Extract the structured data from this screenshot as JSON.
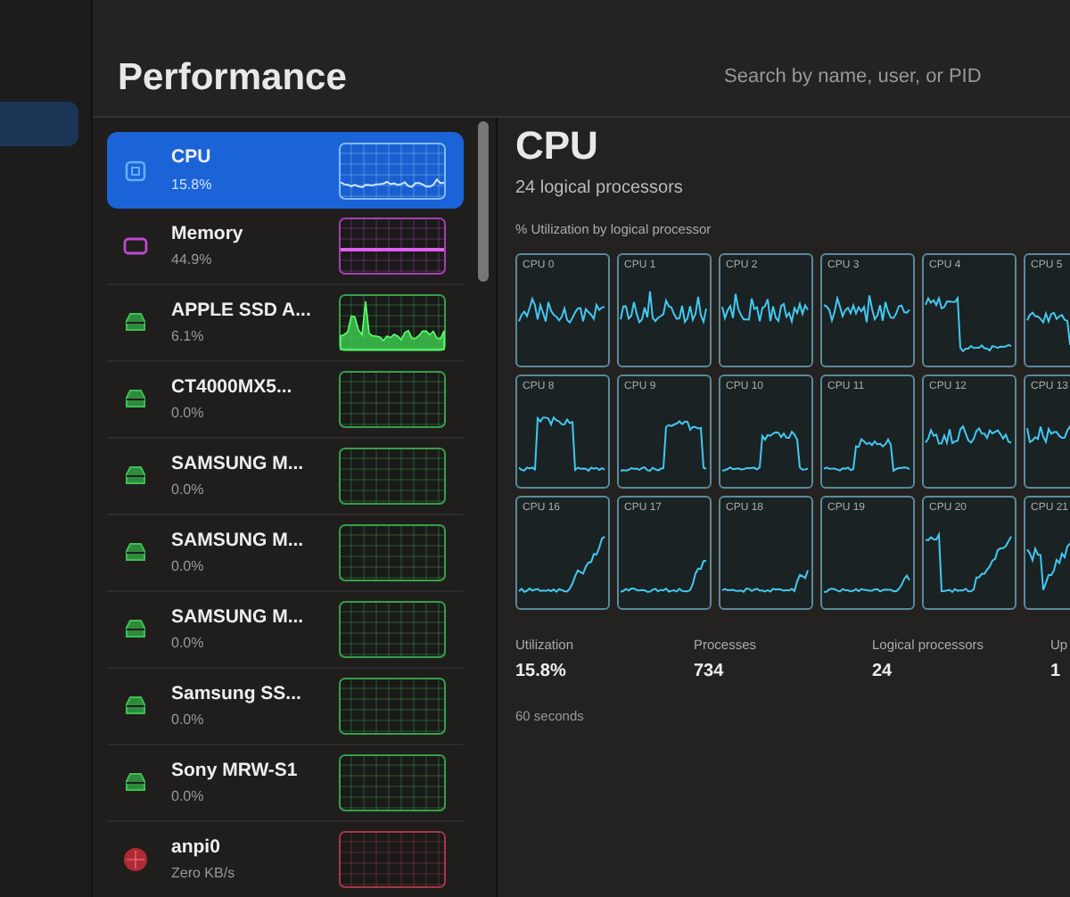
{
  "sidebar": {
    "items": [
      {
        "selected": true
      }
    ]
  },
  "title": "Performance",
  "search": {
    "placeholder": "Search by name, user, or PID"
  },
  "devices": [
    {
      "kind": "cpu",
      "name": "CPU",
      "value": "15.8%",
      "selected": true
    },
    {
      "kind": "memory",
      "name": "Memory",
      "value": "44.9%",
      "selected": false
    },
    {
      "kind": "disk",
      "name": "APPLE SSD A...",
      "value": "6.1%",
      "selected": false
    },
    {
      "kind": "disk",
      "name": "CT4000MX5...",
      "value": "0.0%",
      "selected": false
    },
    {
      "kind": "disk",
      "name": "SAMSUNG M...",
      "value": "0.0%",
      "selected": false
    },
    {
      "kind": "disk",
      "name": "SAMSUNG M...",
      "value": "0.0%",
      "selected": false
    },
    {
      "kind": "disk",
      "name": "SAMSUNG M...",
      "value": "0.0%",
      "selected": false
    },
    {
      "kind": "disk",
      "name": "Samsung SS...",
      "value": "0.0%",
      "selected": false
    },
    {
      "kind": "disk",
      "name": "Sony MRW-S1",
      "value": "0.0%",
      "selected": false
    },
    {
      "kind": "network",
      "name": "anpi0",
      "value": "Zero KB/s",
      "selected": false
    }
  ],
  "detail": {
    "title": "CPU",
    "subtitle": "24 logical processors",
    "graph_caption": "% Utilization by logical processor",
    "processors": [
      "CPU 0",
      "CPU 1",
      "CPU 2",
      "CPU 3",
      "CPU 4",
      "CPU 5",
      "CPU 8",
      "CPU 9",
      "CPU 10",
      "CPU 11",
      "CPU 12",
      "CPU 13",
      "CPU 16",
      "CPU 17",
      "CPU 18",
      "CPU 19",
      "CPU 20",
      "CPU 21"
    ],
    "stats": [
      {
        "label": "Utilization",
        "value": "15.8%"
      },
      {
        "label": "Processes",
        "value": "734"
      },
      {
        "label": "Logical processors",
        "value": "24"
      },
      {
        "label": "Up",
        "value": "1"
      }
    ],
    "time_label": "60 seconds"
  }
}
